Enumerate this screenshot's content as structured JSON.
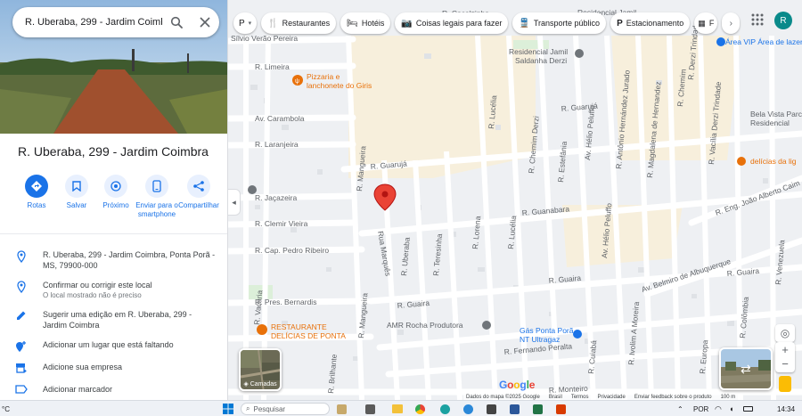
{
  "search": {
    "query": "R. Uberaba, 299 - Jardim Coimbra"
  },
  "place": {
    "title": "R. Uberaba, 299 - Jardim Coimbra"
  },
  "actions": [
    {
      "label": "Rotas",
      "icon": "directions-icon"
    },
    {
      "label": "Salvar",
      "icon": "bookmark-icon"
    },
    {
      "label": "Próximo",
      "icon": "nearby-icon"
    },
    {
      "label": "Enviar para o smartphone",
      "icon": "phone-icon"
    },
    {
      "label": "Compartilhar",
      "icon": "share-icon"
    }
  ],
  "info": {
    "address": "R. Uberaba, 299 - Jardim Coimbra, Ponta Porã - MS, 79900-000",
    "confirm": "Confirmar ou corrigir este local",
    "confirm_sub": "O local mostrado não é preciso",
    "suggest": "Sugerir uma edição em R. Uberaba, 299 - Jardim Coimbra",
    "add_place": "Adicionar um lugar que está faltando",
    "add_business": "Adicione sua empresa",
    "add_label": "Adicionar marcador"
  },
  "chips": {
    "first": "P",
    "items": [
      "Restaurantes",
      "Hotéis",
      "Coisas legais para fazer",
      "Transporte público",
      "Estacionamento",
      "F"
    ]
  },
  "account": {
    "initial": "R"
  },
  "map_labels": {
    "streets": [
      "Sílvio Verão Pereira",
      "R. Limeira",
      "Av. Carambola",
      "R. Laranjeira",
      "R. Jaçazeira",
      "R. Clemir Vieira",
      "R. Cap. Pedro Ribeiro",
      "R. Pres. Bernardis",
      "R. Mangueira",
      "R. Mangueira",
      "R. Guarujá",
      "R. Guarujá",
      "R. Uberaba",
      "R. Teresinha",
      "R. Lorena",
      "R. Lucélia",
      "R. Lucélia",
      "R. Chemim Derzi",
      "R. Estefânia",
      "R. Antônio Hernández Jurado",
      "Av. Hélio Peluffo",
      "Av. Hélio Peluffo",
      "R. Magdalena de Hernandez",
      "R. Guanabara",
      "R. Guaira",
      "R. Guaira",
      "R. Guaira",
      "Av. Belmiro de Albuquerque",
      "R. Fernando Peralta",
      "R. Vacaria",
      "R. Cuiabá",
      "R. Ivolim A Moreira",
      "R. Europa",
      "R. Colômbia",
      "R. Venezuela",
      "R. Monteiro",
      "R. Brilhante",
      "Rua Marquês",
      "R. Eng. João Alberto Caim",
      "R. Vacília Derzi Trindade",
      "R. Chemim",
      "R. Derzi Trindade",
      "Residencial Jamil",
      "R. Cocalzinho"
    ],
    "poi_pizza": [
      "Pizzaria e",
      "lanchonete do Giris"
    ],
    "poi_residencial": [
      "Residencial Jamil",
      "Saldanha Derzi"
    ],
    "poi_area_vip": "Área VIP Área de lazer",
    "poi_bela_vista": [
      "Bela Vista Parc",
      "Residencial"
    ],
    "poi_delicias_lig": "delícias da lig",
    "poi_restaurante": [
      "RESTAURANTE",
      "DELÍCIAS DE PONTA"
    ],
    "poi_amr": "AMR Rocha Produtora",
    "poi_gas": [
      "Gás Ponta Porã",
      "NT Ultragaz"
    ]
  },
  "layers_label": "Camadas",
  "footer": {
    "data": "Dados do mapa ©2025 Google",
    "brasil": "Brasil",
    "terms": "Termos",
    "privacy": "Privacidade",
    "feedback": "Enviar feedback sobre o produto",
    "scale": "100 m"
  },
  "google_logo": "Google",
  "taskbar": {
    "temp": "°C",
    "search_placeholder": "Pesquisar",
    "lang": "POR",
    "time": "14:34"
  },
  "colors": {
    "accent": "#1a73e8",
    "pin": "#ea4335",
    "poi_orange": "#e8710a",
    "avatar": "#0a8a8a"
  }
}
